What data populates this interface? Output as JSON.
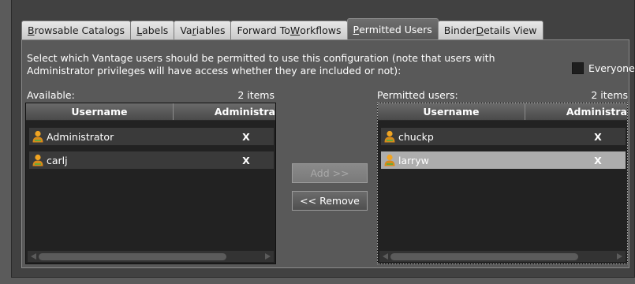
{
  "tabs": [
    {
      "pre": "",
      "mn": "B",
      "post": "rowsable Catalogs",
      "active": false
    },
    {
      "pre": "",
      "mn": "L",
      "post": "abels",
      "active": false
    },
    {
      "pre": "Va",
      "mn": "r",
      "post": "iables",
      "active": false
    },
    {
      "pre": "Forward To ",
      "mn": "W",
      "post": "orkflows",
      "active": false
    },
    {
      "pre": "",
      "mn": "P",
      "post": "ermitted Users",
      "active": true
    },
    {
      "pre": "Binder ",
      "mn": "D",
      "post": "etails View",
      "active": false
    }
  ],
  "description": "Select which Vantage users should be permitted to use this configuration (note that users with Administrator privileges will have access whether they are included or not):",
  "everyone_label": "Everyone",
  "available": {
    "label": "Available:",
    "count": "2 items",
    "col_username": "Username",
    "col_admin": "Administra",
    "rows": [
      {
        "username": "Administrator",
        "admin": "X"
      },
      {
        "username": "carlj",
        "admin": "X"
      }
    ]
  },
  "permitted": {
    "label": "Permitted users:",
    "count": "2 items",
    "col_username": "Username",
    "col_admin": "Administra",
    "rows": [
      {
        "username": "chuckp",
        "admin": "X"
      },
      {
        "username": "larryw",
        "admin": "X"
      }
    ]
  },
  "buttons": {
    "add": "Add >>",
    "remove": "<< Remove"
  },
  "colors": {
    "accent_selected_row": "#adadad",
    "panel_bg": "#595959",
    "list_bg": "#222222",
    "user_icon": "#e8a020"
  }
}
